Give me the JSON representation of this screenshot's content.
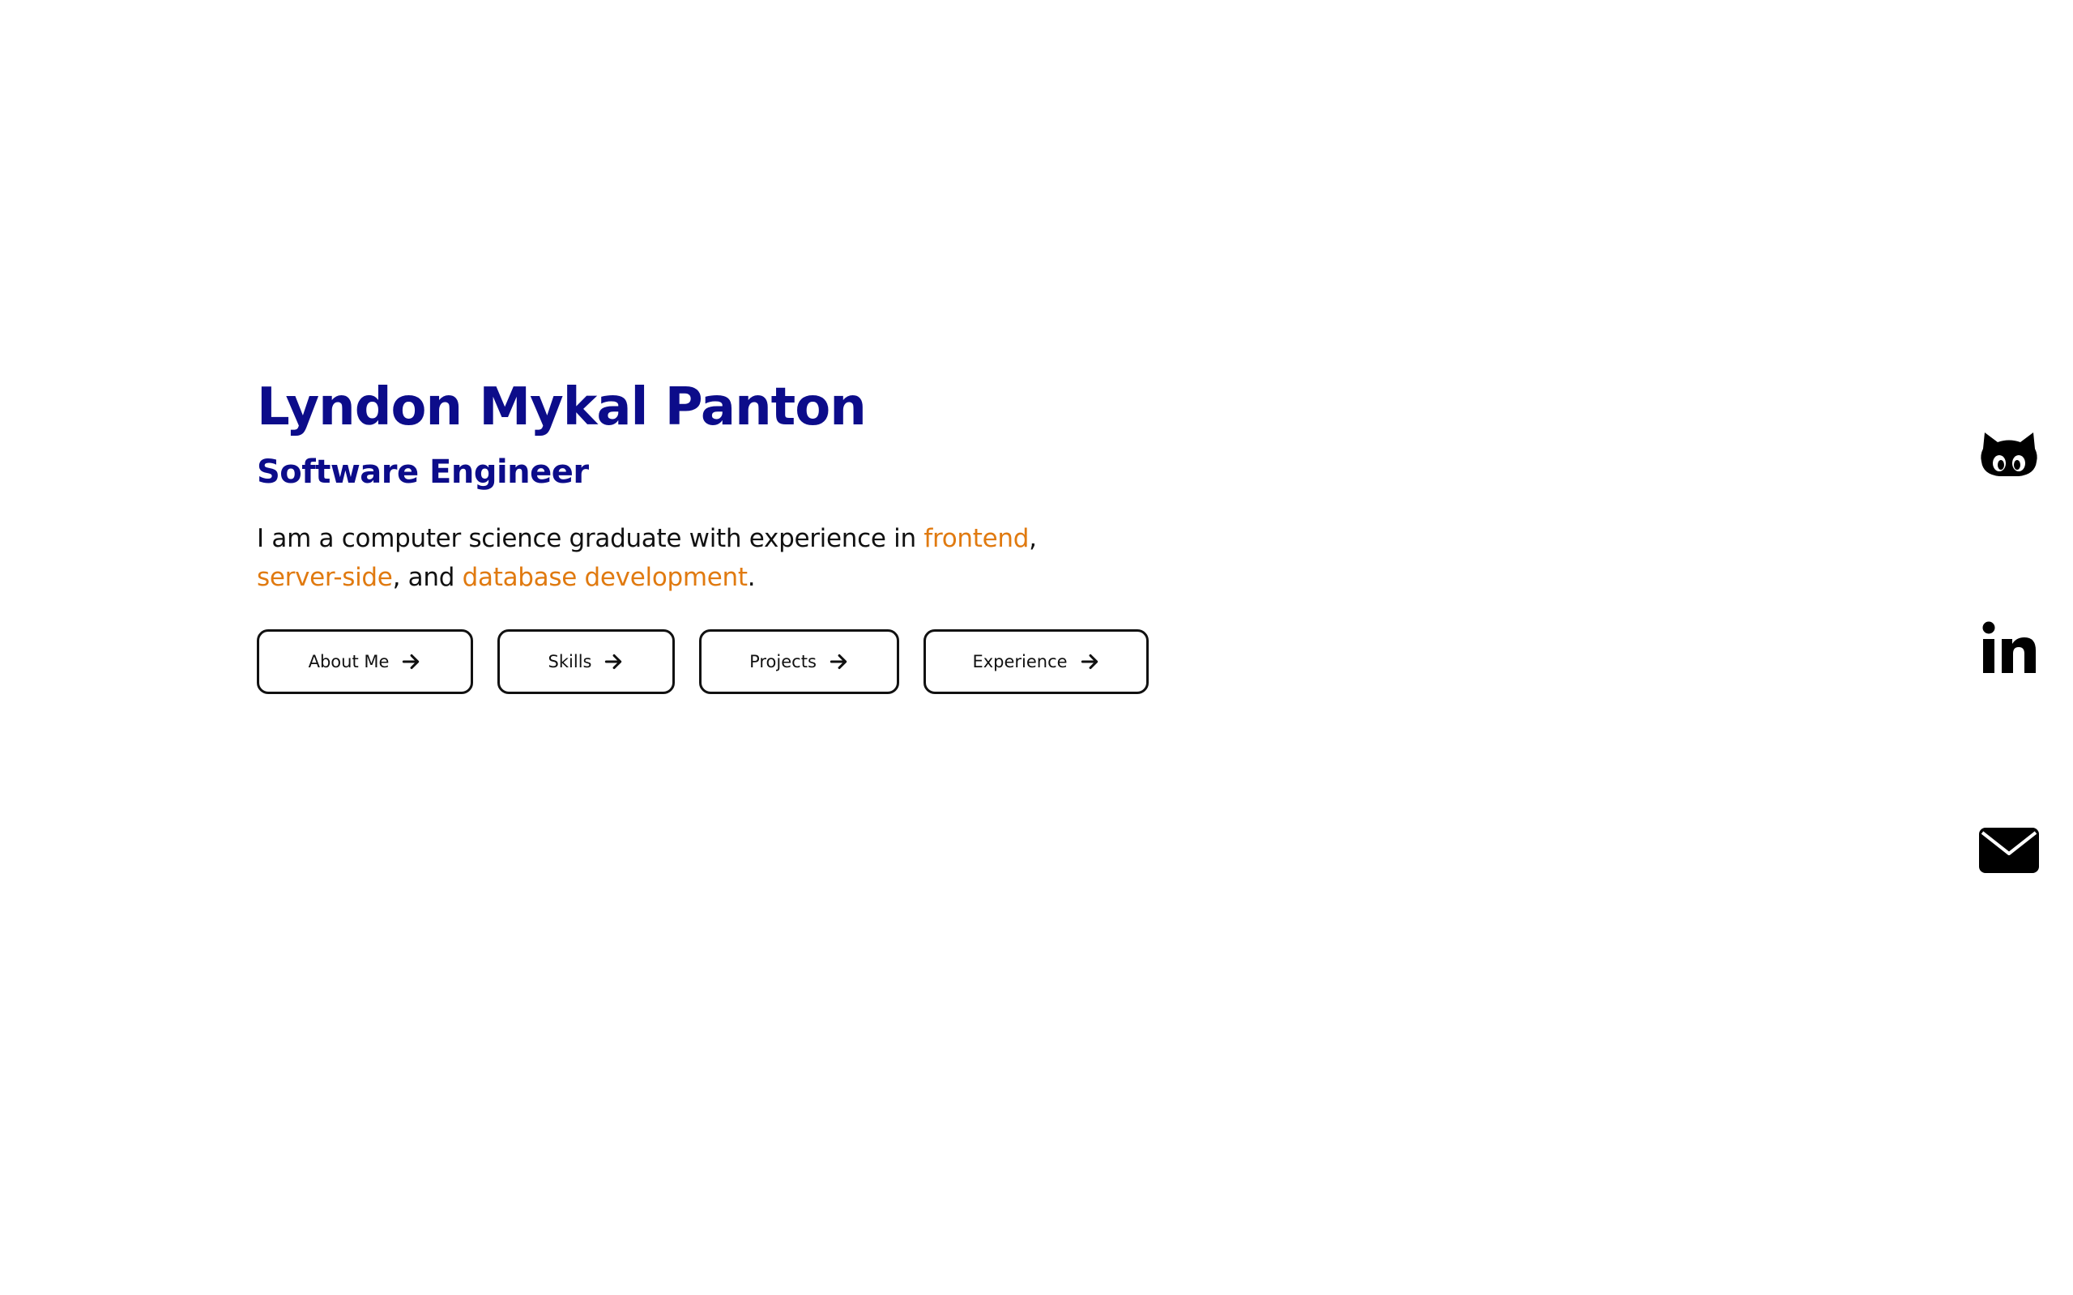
{
  "hero": {
    "name": "Lyndon Mykal Panton",
    "title": "Software Engineer",
    "bio": {
      "intro": "I am a computer science graduate with experience in ",
      "highlight1": "frontend",
      "sep1": ",",
      "highlight2": "server-side",
      "sep2": ", and ",
      "highlight3": "database development",
      "end": "."
    }
  },
  "buttons": [
    {
      "label": "About Me",
      "icon": "arrow-right-icon"
    },
    {
      "label": "Skills",
      "icon": "arrow-right-icon"
    },
    {
      "label": "Projects",
      "icon": "arrow-right-icon"
    },
    {
      "label": "Experience",
      "icon": "arrow-right-icon"
    }
  ],
  "social": [
    {
      "icon": "github-icon"
    },
    {
      "icon": "linkedin-icon"
    },
    {
      "icon": "email-icon"
    }
  ],
  "colors": {
    "heading": "#0c0c8a",
    "highlight": "#e07a10",
    "text": "#111111",
    "background": "#ffffff"
  }
}
